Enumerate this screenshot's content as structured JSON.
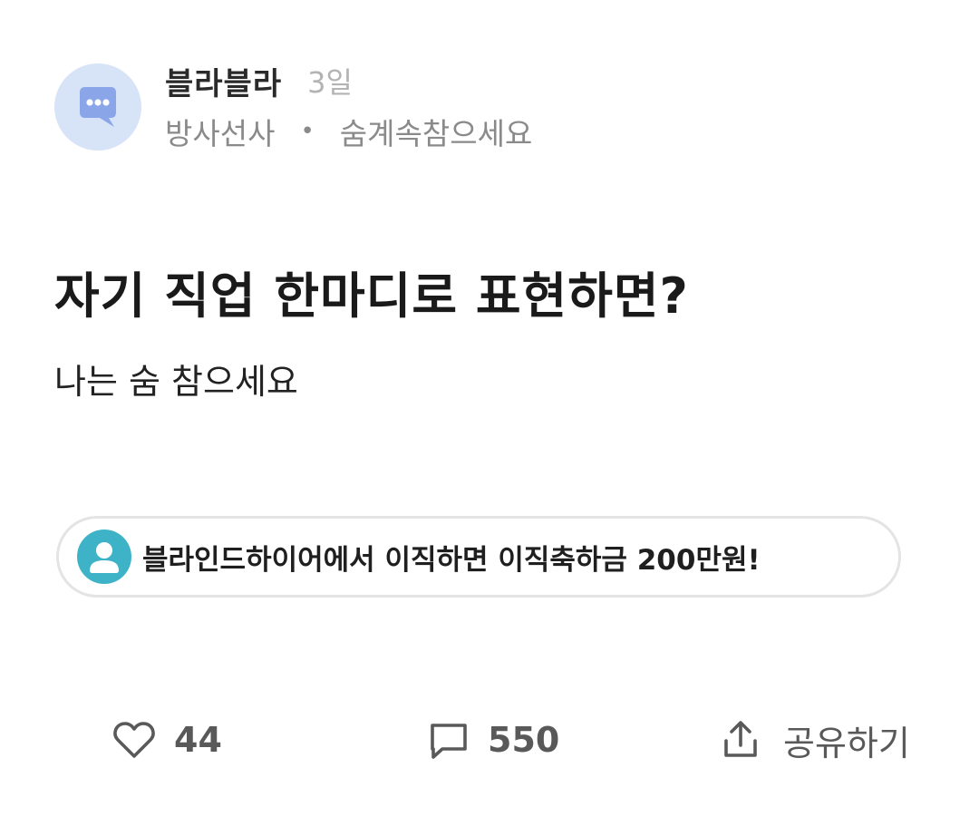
{
  "post": {
    "author": "블라블라",
    "time": "3일",
    "job": "방사선사",
    "nickname": "숨계속참으세요",
    "title": "자기 직업 한마디로 표현하면?",
    "body": "나는 숨 참으세요"
  },
  "promo": {
    "text": "블라인드하이어에서 이직하면 이직축하금 200만원!"
  },
  "actions": {
    "like_count": "44",
    "comment_count": "550",
    "share_label": "공유하기"
  },
  "icons": {
    "avatar": "speech-bubble-icon",
    "promo": "user-icon",
    "like": "heart-icon",
    "comment": "comment-icon",
    "share": "share-icon"
  },
  "colors": {
    "avatar_bg": "#d7e3f7",
    "avatar_bubble": "#8aa6e8",
    "promo_icon_bg": "#3eb3c7",
    "muted_text": "#8a8a8a",
    "time_text": "#b3b3b3"
  }
}
